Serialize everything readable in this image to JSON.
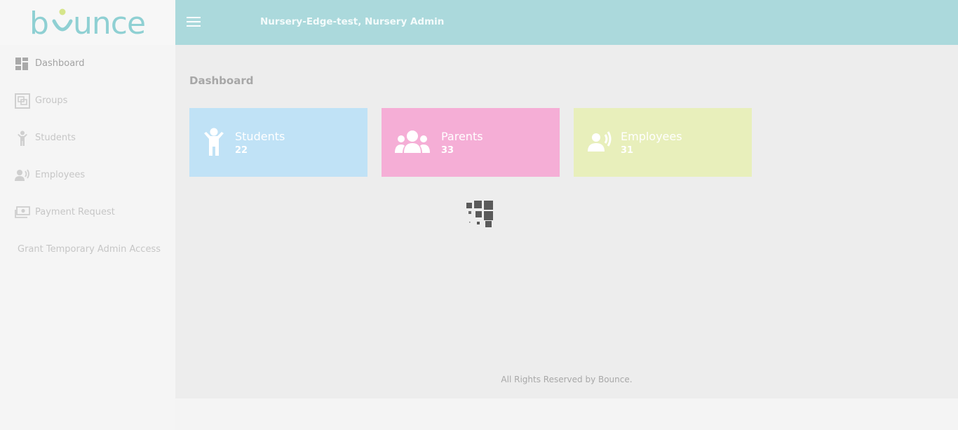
{
  "brand": {
    "name": "bounce"
  },
  "sidebar": {
    "items": [
      {
        "label": "Dashboard",
        "icon": "dashboard-icon"
      },
      {
        "label": "Groups",
        "icon": "groups-icon"
      },
      {
        "label": "Students",
        "icon": "child-icon"
      },
      {
        "label": "Employees",
        "icon": "employee-icon"
      },
      {
        "label": "Payment Request",
        "icon": "money-icon"
      },
      {
        "label": "Grant Temporary Admin Access"
      }
    ]
  },
  "header": {
    "title": "Nursery-Edge-test, Nursery Admin",
    "menu_icon": "hamburger-icon"
  },
  "main": {
    "page_title": "Dashboard",
    "cards": [
      {
        "title": "Students",
        "count": "22",
        "icon": "child-icon",
        "color": "#c0e2f6"
      },
      {
        "title": "Parents",
        "count": "33",
        "icon": "family-icon",
        "color": "#f5aed6"
      },
      {
        "title": "Employees",
        "count": "31",
        "icon": "employee-icon",
        "color": "#e8efbb"
      }
    ]
  },
  "footer": {
    "text": "All Rights Reserved by Bounce."
  },
  "colors": {
    "topbar": "#abd9dc",
    "logo": "#8fd0d3",
    "logo_dot": "#d6e58a"
  }
}
